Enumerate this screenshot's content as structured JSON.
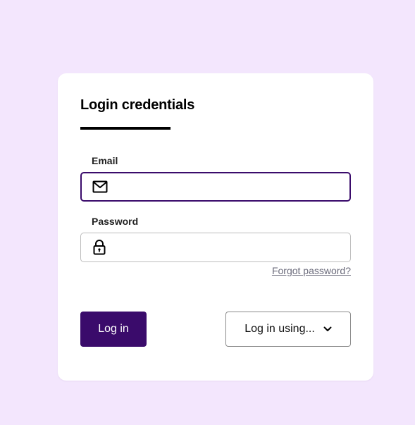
{
  "form": {
    "title": "Login credentials",
    "email": {
      "label": "Email",
      "value": "",
      "icon": "envelope-icon"
    },
    "password": {
      "label": "Password",
      "value": "",
      "icon": "lock-icon"
    },
    "forgot_link": "Forgot password?",
    "login_button": "Log in",
    "login_using_button": "Log in using...",
    "login_using_icon": "chevron-down-icon"
  },
  "colors": {
    "page_background": "#f3e6fd",
    "card_background": "#ffffff",
    "primary": "#3a0b6b",
    "focus_border": "#3a0b6b",
    "input_border": "#bdbdbd",
    "link": "#6b6b7b"
  }
}
